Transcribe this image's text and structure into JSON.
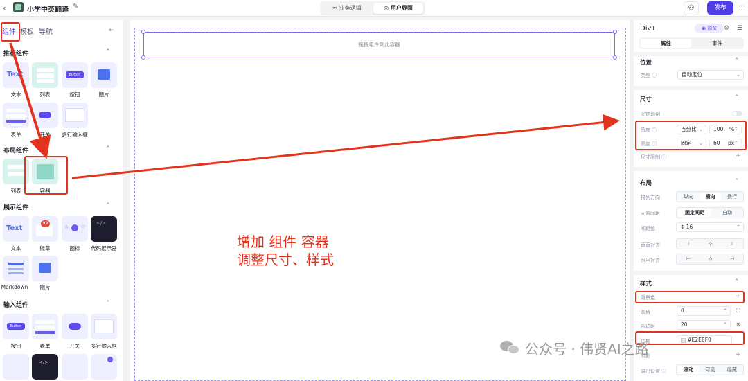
{
  "header": {
    "back_icon": "chevron-left-icon",
    "title": "小学中英翻译",
    "tabs": [
      "业务逻辑",
      "用户界面"
    ],
    "active_tab": "用户界面",
    "publish": "发布",
    "more": "···"
  },
  "left_panel": {
    "tabs": [
      "组件",
      "模板",
      "导航"
    ],
    "active_tab": "组件",
    "collapse_icon": "⇤",
    "sections": [
      {
        "title": "推荐组件",
        "items": [
          "文本",
          "列表",
          "按钮",
          "图片",
          "表单",
          "开关",
          "多行输入框"
        ]
      },
      {
        "title": "布局组件",
        "items": [
          "列表",
          "容器"
        ]
      },
      {
        "title": "展示组件",
        "items": [
          "文本",
          "徽章",
          "图标",
          "代码展示器",
          "Markdown",
          "图片"
        ]
      },
      {
        "title": "输入组件",
        "items": [
          "按钮",
          "表单",
          "开关",
          "多行输入框"
        ]
      }
    ],
    "tile_texts": {
      "text": "Text",
      "button": "Button",
      "badge": "99"
    }
  },
  "canvas": {
    "drop_hint": "拖拽组件到此容器",
    "annotation_line1": "增加 组件 容器",
    "annotation_line2": "调整尺寸、样式"
  },
  "right_panel": {
    "title": "Div1",
    "preview": "◉ 预览",
    "tabs": [
      "属性",
      "事件"
    ],
    "active_tab": "属性",
    "position": {
      "title": "位置",
      "type_label": "类型 ⓘ",
      "type_value": "自动定位"
    },
    "size": {
      "title": "尺寸",
      "fixed_ratio": "固定比例",
      "width_label": "宽度 ⓘ",
      "width_mode": "百分比",
      "width_value": "100",
      "width_unit": "%",
      "height_label": "高度 ⓘ",
      "height_mode": "固定",
      "height_value": "60",
      "height_unit": "px",
      "limit_label": "尺寸限制 ⓘ"
    },
    "layout": {
      "title": "布局",
      "direction_label": "排列方向",
      "direction_options": [
        "纵向",
        "横向",
        "换行"
      ],
      "direction_active": "横向",
      "spacing_label": "元素间距",
      "spacing_options": [
        "固定间距",
        "自动"
      ],
      "spacing_active": "固定间距",
      "gap_label": "间距值",
      "gap_value": "16",
      "valign_label": "垂直对齐",
      "halign_label": "水平对齐"
    },
    "style": {
      "title": "样式",
      "bg_label": "背景色",
      "radius_label": "圆角",
      "radius_value": "0",
      "padding_label": "内边距",
      "padding_value": "20",
      "border_label": "边框",
      "border_value": "#E2E8F0",
      "shadow_label": "阴影",
      "overflow_label": "溢出设置 ⓘ",
      "overflow_options": [
        "滚动",
        "可见",
        "隐藏"
      ],
      "overflow_active": "滚动"
    }
  },
  "watermark": "公众号 · 伟贤AI之路",
  "colors": {
    "accent": "#4E3EE6",
    "annotation": "#E2331F",
    "border_color": "#E2E8F0"
  }
}
